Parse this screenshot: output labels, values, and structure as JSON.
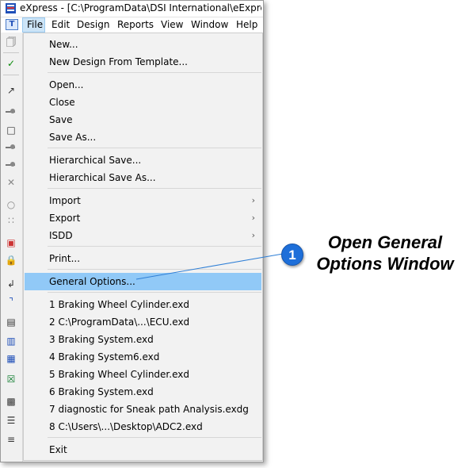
{
  "window": {
    "title": "eXpress - [C:\\ProgramData\\DSI International\\eExpress\\Desi"
  },
  "menubar": {
    "items": [
      "File",
      "Edit",
      "Design",
      "Reports",
      "View",
      "Window",
      "Help"
    ]
  },
  "file_menu": {
    "groups": [
      {
        "items": [
          {
            "label": "New..."
          },
          {
            "label": "New Design From Template..."
          }
        ]
      },
      {
        "items": [
          {
            "label": "Open..."
          },
          {
            "label": "Close"
          },
          {
            "label": "Save"
          },
          {
            "label": "Save As..."
          }
        ]
      },
      {
        "items": [
          {
            "label": "Hierarchical Save..."
          },
          {
            "label": "Hierarchical Save As..."
          }
        ]
      },
      {
        "items": [
          {
            "label": "Import",
            "submenu": true
          },
          {
            "label": "Export",
            "submenu": true
          },
          {
            "label": "ISDD",
            "submenu": true
          }
        ]
      },
      {
        "items": [
          {
            "label": "Print..."
          }
        ]
      },
      {
        "items": [
          {
            "label": "General Options...",
            "highlighted": true
          }
        ]
      },
      {
        "items": [
          {
            "label": "1 Braking Wheel Cylinder.exd"
          },
          {
            "label": "2 C:\\ProgramData\\...\\ECU.exd"
          },
          {
            "label": "3 Braking System.exd"
          },
          {
            "label": "4 Braking System6.exd"
          },
          {
            "label": "5 Braking Wheel Cylinder.exd"
          },
          {
            "label": "6 Braking System.exd"
          },
          {
            "label": "7 diagnostic for Sneak path Analysis.exdg"
          },
          {
            "label": "8 C:\\Users\\...\\Desktop\\ADC2.exd"
          }
        ]
      },
      {
        "items": [
          {
            "label": "Exit"
          }
        ]
      }
    ],
    "submenu_arrow": "›"
  },
  "callout": {
    "number": "1",
    "line1": "Open General",
    "line2": "Options Window",
    "badge_color": "#1e6fd9",
    "line_color": "#2f7fd6"
  },
  "colors": {
    "highlight": "#91c9f7",
    "menu_bg": "#f2f2f2"
  }
}
